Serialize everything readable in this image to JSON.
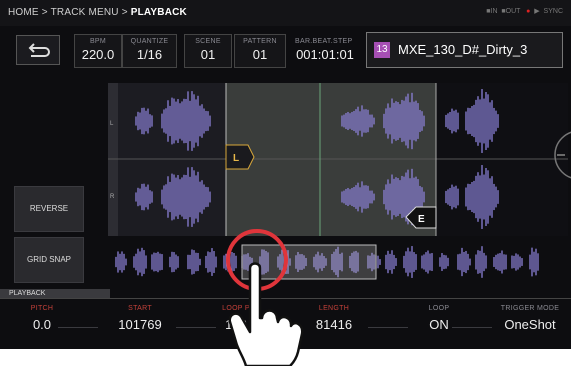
{
  "header": {
    "breadcrumb_path": "HOME > TRACK MENU > ",
    "breadcrumb_current": "PLAYBACK",
    "status": {
      "in": "IN",
      "out": "OUT",
      "sync": "SYNC"
    }
  },
  "info": {
    "bpm": {
      "label": "BPM",
      "value": "220.0"
    },
    "quantize": {
      "label": "QUANTIZE",
      "value": "1/16"
    },
    "scene": {
      "label": "SCENE",
      "value": "01"
    },
    "pattern": {
      "label": "PATTERN",
      "value": "01"
    },
    "bar_beat_step": {
      "label": "BAR.BEAT.STEP",
      "value": "001:01:01"
    }
  },
  "sample": {
    "number": "13",
    "name": "MXE_130_D#_Dirty_3",
    "badge_color": "#a64fb4"
  },
  "waveform": {
    "channel_left": "L",
    "channel_right": "R",
    "start_marker": "L",
    "end_marker": "E",
    "wave_color": "#8a7fd6"
  },
  "buttons": {
    "reverse": "REVERSE",
    "grid_snap": "GRID SNAP"
  },
  "tab": "PLAYBACK",
  "params": {
    "pitch": {
      "label": "PITCH",
      "value": "0.0"
    },
    "start": {
      "label": "START",
      "value": "101769"
    },
    "loop_point": {
      "label": "LOOP P",
      "value": "142"
    },
    "length": {
      "label": "LENGTH",
      "value": "81416"
    },
    "loop": {
      "label": "LOOP",
      "value": "ON"
    },
    "trigger_mode": {
      "label": "TRIGGER MODE",
      "value": "OneShot"
    }
  },
  "accent": {
    "param_label": "#c4413a",
    "touch_circle": "#e0353b"
  }
}
